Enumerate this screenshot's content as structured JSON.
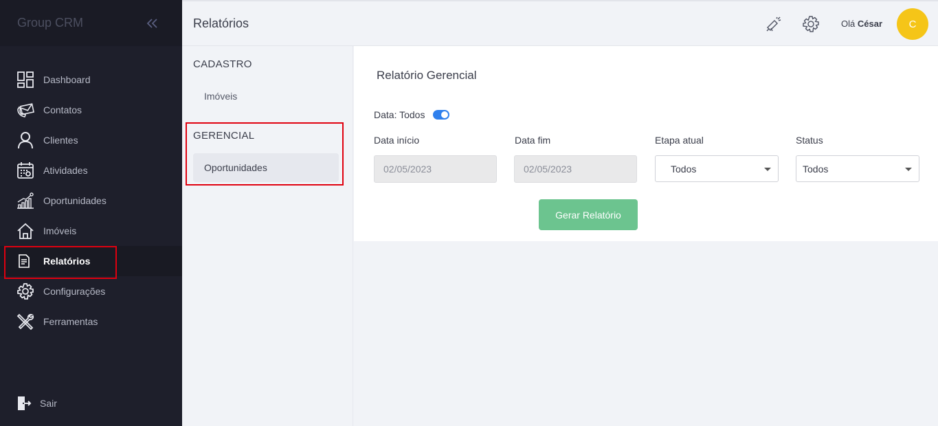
{
  "app": {
    "brand": "Group CRM"
  },
  "sidebar": {
    "items": [
      {
        "label": "Dashboard",
        "icon": "dashboard-icon"
      },
      {
        "label": "Contatos",
        "icon": "contacts-icon"
      },
      {
        "label": "Clientes",
        "icon": "user-icon"
      },
      {
        "label": "Atividades",
        "icon": "calendar-icon"
      },
      {
        "label": "Oportunidades",
        "icon": "chart-growth-icon"
      },
      {
        "label": "Imóveis",
        "icon": "home-icon"
      },
      {
        "label": "Relatórios",
        "icon": "report-icon",
        "active": true
      },
      {
        "label": "Configurações",
        "icon": "gear-icon"
      },
      {
        "label": "Ferramentas",
        "icon": "tools-icon"
      }
    ],
    "logout_label": "Sair"
  },
  "header": {
    "title": "Relatórios",
    "greeting_prefix": "Olá",
    "user_name": "César",
    "avatar_initial": "C"
  },
  "submenu": {
    "sections": [
      {
        "title": "CADASTRO",
        "items": [
          "Imóveis"
        ]
      },
      {
        "title": "GERENCIAL",
        "items": [
          "Oportunidades"
        ]
      }
    ]
  },
  "report": {
    "title": "Relatório Gerencial",
    "date_toggle_label": "Data: Todos",
    "date_toggle_on": true,
    "start_label": "Data início",
    "start_value": "02/05/2023",
    "end_label": "Data fim",
    "end_value": "02/05/2023",
    "stage_label": "Etapa atual",
    "stage_value": "Todos",
    "status_label": "Status",
    "status_value": "Todos",
    "generate_button": "Gerar Relatório"
  },
  "colors": {
    "sidebar_bg": "#1e1f2b",
    "accent_toggle": "#2f80ed",
    "button_green": "#6cc48f",
    "avatar": "#f5c518",
    "highlight_red": "#e0000f"
  }
}
